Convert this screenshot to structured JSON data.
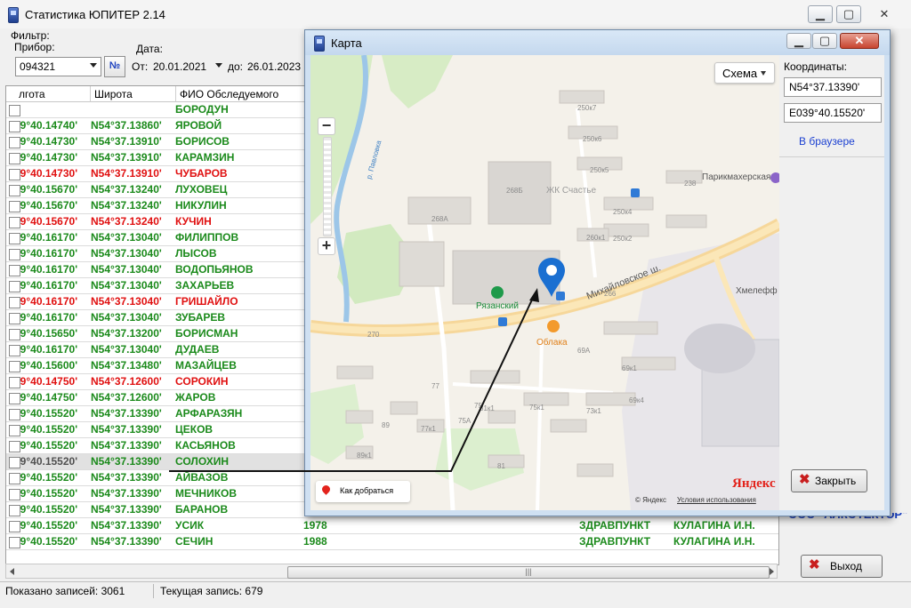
{
  "main_window": {
    "title": "Статистика ЮПИТЕР 2.14",
    "caption_buttons": {
      "minimize": "▁",
      "maximize": "▢",
      "close": "✕"
    }
  },
  "filter": {
    "group_label": "Фильтр:",
    "device_label": "Прибор:",
    "device_value": "094321",
    "number_button": "№",
    "date_label": "Дата:",
    "from_label": "От:",
    "from_value": "20.01.2021",
    "to_label": "до:",
    "to_value": "26.01.2023"
  },
  "grid": {
    "columns": [
      "лгота",
      "Широта",
      "ФИО Обследуемого"
    ],
    "rows": [
      {
        "lon": "",
        "lat": "",
        "name": "БОРОДУН",
        "color": "green"
      },
      {
        "lon": "39°40.14740'",
        "lat": "N54°37.13860'",
        "name": "ЯРОВОЙ",
        "color": "green"
      },
      {
        "lon": "39°40.14730'",
        "lat": "N54°37.13910'",
        "name": "БОРИСОВ",
        "color": "green"
      },
      {
        "lon": "39°40.14730'",
        "lat": "N54°37.13910'",
        "name": "КАРАМЗИН",
        "color": "green"
      },
      {
        "lon": "39°40.14730'",
        "lat": "N54°37.13910'",
        "name": "ЧУБАРОВ",
        "color": "red"
      },
      {
        "lon": "39°40.15670'",
        "lat": "N54°37.13240'",
        "name": "ЛУХОВЕЦ",
        "color": "green"
      },
      {
        "lon": "39°40.15670'",
        "lat": "N54°37.13240'",
        "name": "НИКУЛИН",
        "color": "green"
      },
      {
        "lon": "39°40.15670'",
        "lat": "N54°37.13240'",
        "name": "КУЧИН",
        "color": "red"
      },
      {
        "lon": "39°40.16170'",
        "lat": "N54°37.13040'",
        "name": "ФИЛИППОВ",
        "color": "green"
      },
      {
        "lon": "39°40.16170'",
        "lat": "N54°37.13040'",
        "name": "ЛЫСОВ",
        "color": "green"
      },
      {
        "lon": "39°40.16170'",
        "lat": "N54°37.13040'",
        "name": "ВОДОПЬЯНОВ",
        "color": "green"
      },
      {
        "lon": "39°40.16170'",
        "lat": "N54°37.13040'",
        "name": "ЗАХАРЬЕВ",
        "color": "green"
      },
      {
        "lon": "39°40.16170'",
        "lat": "N54°37.13040'",
        "name": "ГРИШАЙЛО",
        "color": "red"
      },
      {
        "lon": "39°40.16170'",
        "lat": "N54°37.13040'",
        "name": "ЗУБАРЕВ",
        "color": "green"
      },
      {
        "lon": "39°40.15650'",
        "lat": "N54°37.13200'",
        "name": "БОРИСМАН",
        "color": "green"
      },
      {
        "lon": "39°40.16170'",
        "lat": "N54°37.13040'",
        "name": "ДУДАЕВ",
        "color": "green"
      },
      {
        "lon": "39°40.15600'",
        "lat": "N54°37.13480'",
        "name": "МАЗАЙЦЕВ",
        "color": "green"
      },
      {
        "lon": "39°40.14750'",
        "lat": "N54°37.12600'",
        "name": "СОРОКИН",
        "color": "red"
      },
      {
        "lon": "39°40.14750'",
        "lat": "N54°37.12600'",
        "name": "ЖАРОВ",
        "color": "green"
      },
      {
        "lon": "39°40.15520'",
        "lat": "N54°37.13390'",
        "name": "АРФАРАЗЯН",
        "color": "green"
      },
      {
        "lon": "39°40.15520'",
        "lat": "N54°37.13390'",
        "name": "ЦЕКОВ",
        "color": "green"
      },
      {
        "lon": "39°40.15520'",
        "lat": "N54°37.13390'",
        "name": "КАСЬЯНОВ",
        "color": "green"
      },
      {
        "lon": "39°40.15520'",
        "lat": "N54°37.13390'",
        "name": "СОЛОХИН",
        "color": "green",
        "selected": true
      },
      {
        "lon": "39°40.15520'",
        "lat": "N54°37.13390'",
        "name": "АЙВАЗОВ",
        "color": "green"
      },
      {
        "lon": "39°40.15520'",
        "lat": "N54°37.13390'",
        "name": "МЕЧНИКОВ",
        "color": "green"
      },
      {
        "lon": "39°40.15520'",
        "lat": "N54°37.13390'",
        "name": "БАРАНОВ",
        "color": "green"
      },
      {
        "lon": "39°40.15520'",
        "lat": "N54°37.13390'",
        "name": "УСИК",
        "color": "green",
        "year": "1978",
        "place": "ЗДРАВПУНКТ",
        "doctor": "КУЛАГИНА И.Н."
      },
      {
        "lon": "39°40.15520'",
        "lat": "N54°37.13390'",
        "name": "СЕЧИН",
        "color": "green",
        "year": "1988",
        "place": "ЗДРАВПУНКТ",
        "doctor": "КУЛАГИНА И.Н."
      }
    ]
  },
  "behind_text": "ООО \"АЛКОТЕКТОР\"",
  "exit_button": "Выход",
  "status": {
    "shown": "Показано записей: 3061",
    "current": "Текущая запись: 679"
  },
  "map_window": {
    "title": "Карта",
    "scheme_button": "Схема",
    "coords_label": "Координаты:",
    "lat_value": "N54°37.13390'",
    "lon_value": "E039°40.15520'",
    "browser_link": "В браузере",
    "close_button": "Закрыть",
    "route_label": "Как добраться",
    "copyright": "© Яндекс",
    "terms": "Условия использования",
    "logo": "Яндекс",
    "streets": {
      "main": "Михайловское ш.",
      "river": "р. Павловка"
    },
    "pois": {
      "shop": "Рязанский",
      "cafe": "Облака",
      "complex": "ЖК Счастье",
      "salon": "Парикмахерская",
      "bakery": "Хмелефф"
    },
    "house_numbers": [
      "250к7",
      "250к6",
      "250к5",
      "250к4",
      "238",
      "268Б",
      "268А",
      "250к2",
      "260к1",
      "266",
      "270",
      "69А",
      "69к1",
      "77",
      "75",
      "81к1",
      "75к1",
      "73к1",
      "69к4",
      "77к1",
      "75А",
      "89",
      "89к1",
      "89к2",
      "81"
    ]
  }
}
